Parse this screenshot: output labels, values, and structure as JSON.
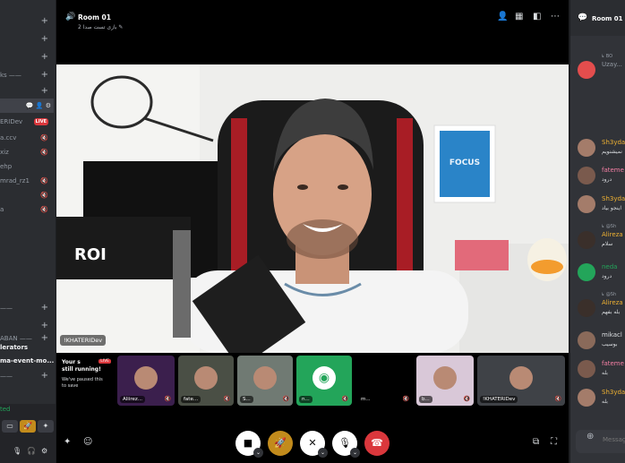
{
  "sidebar": {
    "channels": [
      {
        "label": "",
        "has_plus": true
      },
      {
        "label": "",
        "has_plus": true
      },
      {
        "label": "",
        "has_plus": true
      },
      {
        "label": "ks ——",
        "has_plus": true
      },
      {
        "label": "",
        "has_plus": true
      },
      {
        "label": "",
        "has_plus": false
      },
      {
        "label": "",
        "active": true,
        "icons": "💬 👤 ⚙"
      },
      {
        "label": "ERIDev",
        "live": true,
        "live_label": "LIVE"
      },
      {
        "label": "a.ccv",
        "mute": true
      },
      {
        "label": "xiz",
        "mute": true
      },
      {
        "label": "ehp",
        "mute": false
      },
      {
        "label": "mrad_rz1",
        "mute": true
      },
      {
        "label": "",
        "mute": true
      },
      {
        "label": "a",
        "mute": true
      },
      {
        "label": "",
        "mute": false
      },
      {
        "label": "——",
        "has_plus": true
      },
      {
        "label": "",
        "has_plus": true
      },
      {
        "label": "ABAN ——",
        "has_plus": true
      },
      {
        "label": "lerators",
        "bold": true
      },
      {
        "label": "ma-event-mo...",
        "bold": true
      },
      {
        "label": "——",
        "has_plus": true
      },
      {
        "label": "",
        "has_plus": false
      }
    ],
    "user_panel": {
      "status": "ted",
      "icons": [
        "🎙",
        "🎧",
        "⚙"
      ]
    }
  },
  "call": {
    "room_title": "Room 01",
    "room_subtitle": "بازی تست صدا 2 ✎",
    "header_icons": [
      "add-member",
      "grid",
      "popout",
      "more"
    ],
    "main_speaker_name": "!KHATERIDev",
    "tiles": [
      {
        "label": "",
        "kind": "stream",
        "title_line1": "Your s",
        "title_line2": "still running!",
        "body": "We've paused this",
        "body2": "to save"
      },
      {
        "label": "Aliirez...",
        "kind": "video",
        "color": "#3b1f4d"
      },
      {
        "label": "fate...",
        "kind": "video",
        "color": "#4a4f45"
      },
      {
        "label": "S...",
        "kind": "video",
        "color": "#707a73"
      },
      {
        "label": "n...",
        "kind": "discord",
        "color": "#23a55a"
      },
      {
        "label": "m...",
        "kind": "empty",
        "color": "#000000"
      },
      {
        "label": "b...",
        "kind": "video",
        "color": "#d9c8d8"
      },
      {
        "label": "!KHATERIDev",
        "kind": "video",
        "color": "#3f4247"
      }
    ],
    "controls": {
      "camera": "■",
      "activity": "🚀",
      "screenshare": "✕",
      "mic": "🎙",
      "leave": "☎"
    }
  },
  "chat": {
    "title": "Room 01",
    "messages": [
      {
        "name": "Uzay...",
        "name_color": "#949ba4",
        "text": "",
        "reply": "↳ BO",
        "avatar_color": "#e34d4d",
        "bot": true
      },
      {
        "name": "Sh3yda",
        "name_color": "#f0b232",
        "text": "نمیشنویم",
        "reply": "",
        "avatar_color": "#a47c6a"
      },
      {
        "name": "fateme",
        "name_color": "#f47fa4",
        "text": "درود",
        "reply": "",
        "avatar_color": "#7a5a4d"
      },
      {
        "name": "Sh3yda",
        "name_color": "#f0b232",
        "text": "اینجو بیاد",
        "reply": "",
        "avatar_color": "#a47c6a"
      },
      {
        "name": "Alireza",
        "name_color": "#f0b232",
        "text": "سلام",
        "reply": "↳ @Sh",
        "avatar_color": "#3a2f2a"
      },
      {
        "name": "neda",
        "name_color": "#23a55a",
        "text": "درود",
        "reply": "",
        "avatar_color": "#23a55a"
      },
      {
        "name": "Alireza",
        "name_color": "#f0b232",
        "text": "بله بفهم",
        "reply": "↳ @Sh",
        "avatar_color": "#3a2f2a"
      },
      {
        "name": "mikacl",
        "name_color": "#dbdee1",
        "text": "بوسیب",
        "reply": "",
        "avatar_color": "#8a6a5a"
      },
      {
        "name": "fateme",
        "name_color": "#f47fa4",
        "text": "بله",
        "reply": "",
        "avatar_color": "#7a5a4d"
      },
      {
        "name": "Sh3yda",
        "name_color": "#f0b232",
        "text": "بله",
        "reply": "",
        "avatar_color": "#a47c6a"
      }
    ],
    "input_placeholder": "Messag"
  }
}
